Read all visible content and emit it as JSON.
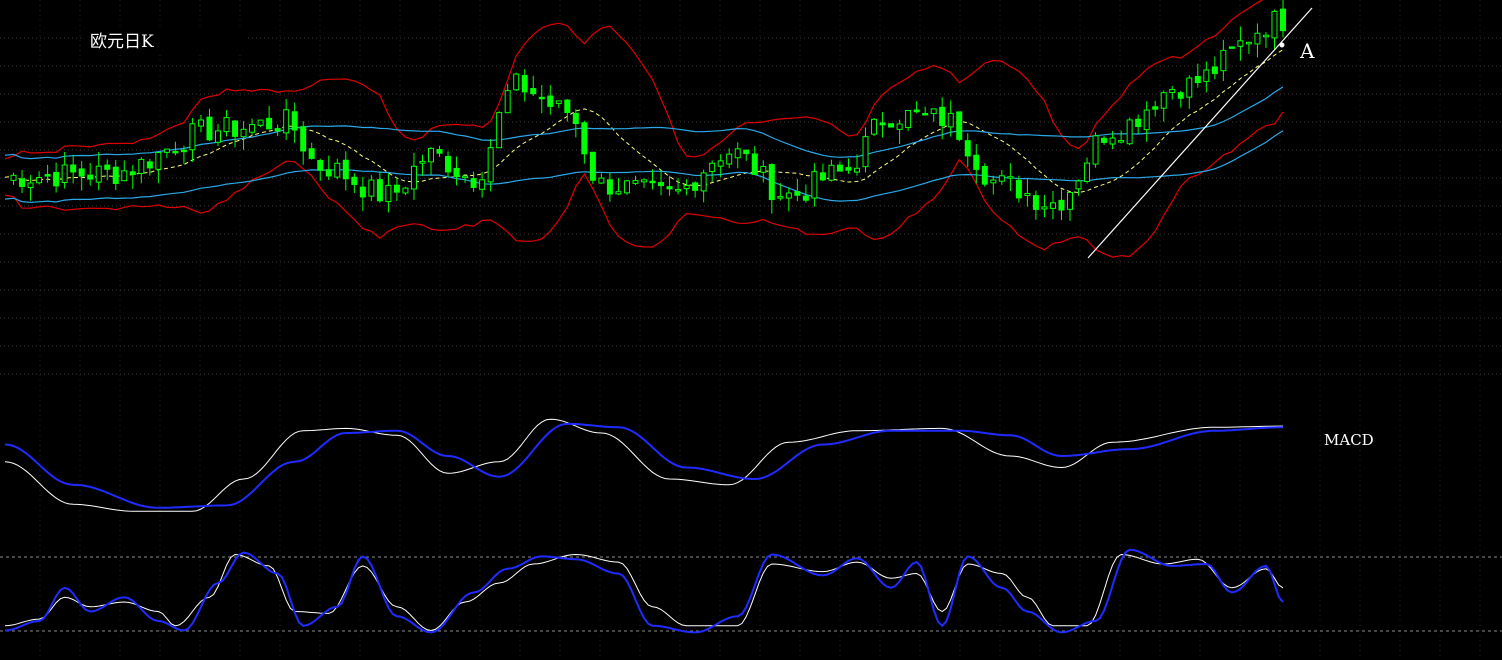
{
  "chart_data": [
    {
      "type": "candlestick",
      "title": "欧元日K",
      "annotation": "A",
      "colors": {
        "candle": "#00ff00",
        "bollinger": "#e00000",
        "ma_long": "#2aa8e8",
        "ma_mid": "#ffff80",
        "trendline": "#ffffff"
      },
      "price_waypoints": [
        [
          0,
          0.57
        ],
        [
          12,
          0.58
        ],
        [
          25,
          0.7
        ],
        [
          33,
          0.72
        ],
        [
          37,
          0.6
        ],
        [
          45,
          0.52
        ],
        [
          50,
          0.63
        ],
        [
          55,
          0.57
        ],
        [
          60,
          0.82
        ],
        [
          66,
          0.75
        ],
        [
          70,
          0.55
        ],
        [
          78,
          0.52
        ],
        [
          85,
          0.64
        ],
        [
          92,
          0.52
        ],
        [
          98,
          0.58
        ],
        [
          104,
          0.74
        ],
        [
          110,
          0.73
        ],
        [
          117,
          0.55
        ],
        [
          123,
          0.5
        ],
        [
          130,
          0.7
        ],
        [
          138,
          0.82
        ],
        [
          150,
          1.0
        ]
      ],
      "ylim": [
        0,
        1
      ],
      "xlim": [
        0,
        150
      ]
    },
    {
      "type": "line",
      "title": "MACD",
      "series": [
        {
          "color": "#ffffff",
          "points": [
            [
              0,
              0.55
            ],
            [
              8,
              0.18
            ],
            [
              15,
              0.12
            ],
            [
              22,
              0.12
            ],
            [
              28,
              0.4
            ],
            [
              35,
              0.82
            ],
            [
              40,
              0.84
            ],
            [
              46,
              0.78
            ],
            [
              52,
              0.45
            ],
            [
              58,
              0.55
            ],
            [
              64,
              0.92
            ],
            [
              70,
              0.8
            ],
            [
              78,
              0.4
            ],
            [
              85,
              0.35
            ],
            [
              92,
              0.72
            ],
            [
              100,
              0.82
            ],
            [
              110,
              0.84
            ],
            [
              118,
              0.6
            ],
            [
              124,
              0.5
            ],
            [
              130,
              0.72
            ],
            [
              142,
              0.85
            ],
            [
              150,
              0.86
            ]
          ]
        },
        {
          "color": "#1f2bff",
          "points": [
            [
              0,
              0.7
            ],
            [
              8,
              0.35
            ],
            [
              18,
              0.15
            ],
            [
              26,
              0.17
            ],
            [
              34,
              0.55
            ],
            [
              40,
              0.8
            ],
            [
              46,
              0.82
            ],
            [
              52,
              0.6
            ],
            [
              58,
              0.42
            ],
            [
              66,
              0.88
            ],
            [
              72,
              0.85
            ],
            [
              80,
              0.5
            ],
            [
              88,
              0.4
            ],
            [
              96,
              0.7
            ],
            [
              104,
              0.82
            ],
            [
              112,
              0.82
            ],
            [
              118,
              0.78
            ],
            [
              124,
              0.6
            ],
            [
              132,
              0.66
            ],
            [
              142,
              0.82
            ],
            [
              150,
              0.85
            ]
          ]
        }
      ],
      "ylim": [
        0,
        1
      ]
    },
    {
      "type": "line",
      "title": "",
      "series": [
        {
          "color": "#ffffff",
          "points": [
            [
              0,
              0.15
            ],
            [
              4,
              0.22
            ],
            [
              7,
              0.45
            ],
            [
              10,
              0.35
            ],
            [
              14,
              0.4
            ],
            [
              18,
              0.3
            ],
            [
              20,
              0.15
            ],
            [
              24,
              0.45
            ],
            [
              27,
              0.9
            ],
            [
              31,
              0.78
            ],
            [
              34,
              0.3
            ],
            [
              38,
              0.28
            ],
            [
              42,
              0.78
            ],
            [
              46,
              0.35
            ],
            [
              50,
              0.1
            ],
            [
              54,
              0.4
            ],
            [
              58,
              0.6
            ],
            [
              62,
              0.8
            ],
            [
              67,
              0.9
            ],
            [
              72,
              0.82
            ],
            [
              76,
              0.35
            ],
            [
              80,
              0.15
            ],
            [
              86,
              0.15
            ],
            [
              90,
              0.8
            ],
            [
              96,
              0.72
            ],
            [
              100,
              0.82
            ],
            [
              104,
              0.65
            ],
            [
              107,
              0.7
            ],
            [
              110,
              0.3
            ],
            [
              113,
              0.8
            ],
            [
              117,
              0.7
            ],
            [
              120,
              0.45
            ],
            [
              123,
              0.15
            ],
            [
              127,
              0.15
            ],
            [
              131,
              0.9
            ],
            [
              136,
              0.8
            ],
            [
              140,
              0.85
            ],
            [
              144,
              0.55
            ],
            [
              148,
              0.75
            ],
            [
              150,
              0.55
            ]
          ]
        },
        {
          "color": "#1f2bff",
          "points": [
            [
              0,
              0.1
            ],
            [
              4,
              0.2
            ],
            [
              7,
              0.55
            ],
            [
              10,
              0.3
            ],
            [
              14,
              0.45
            ],
            [
              18,
              0.2
            ],
            [
              21,
              0.1
            ],
            [
              25,
              0.6
            ],
            [
              28,
              0.92
            ],
            [
              32,
              0.7
            ],
            [
              35,
              0.15
            ],
            [
              39,
              0.35
            ],
            [
              42,
              0.88
            ],
            [
              46,
              0.25
            ],
            [
              50,
              0.08
            ],
            [
              55,
              0.5
            ],
            [
              59,
              0.75
            ],
            [
              63,
              0.88
            ],
            [
              67,
              0.85
            ],
            [
              72,
              0.7
            ],
            [
              76,
              0.15
            ],
            [
              81,
              0.08
            ],
            [
              86,
              0.25
            ],
            [
              90,
              0.9
            ],
            [
              96,
              0.68
            ],
            [
              100,
              0.86
            ],
            [
              104,
              0.55
            ],
            [
              107,
              0.82
            ],
            [
              110,
              0.15
            ],
            [
              113,
              0.88
            ],
            [
              117,
              0.55
            ],
            [
              120,
              0.3
            ],
            [
              124,
              0.08
            ],
            [
              128,
              0.2
            ],
            [
              132,
              0.95
            ],
            [
              137,
              0.78
            ],
            [
              141,
              0.8
            ],
            [
              144,
              0.5
            ],
            [
              148,
              0.78
            ],
            [
              150,
              0.4
            ]
          ]
        }
      ],
      "ylim": [
        0,
        1
      ]
    }
  ]
}
